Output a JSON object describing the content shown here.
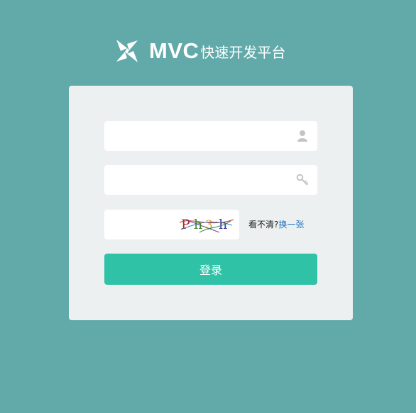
{
  "brand": {
    "logo_icon": "pinwheel-logo-icon",
    "main": "MVC",
    "sub": "快速开发平台"
  },
  "form": {
    "username": {
      "value": "",
      "icon": "user-icon"
    },
    "password": {
      "value": "",
      "icon": "key-icon"
    },
    "captcha": {
      "value": "",
      "image_text": "Ph3h",
      "chars": [
        "P",
        "h",
        "3",
        "h"
      ],
      "char_colors": [
        "#b22a2a",
        "#3a8a2a",
        "#e0a020",
        "#3a3aa0"
      ],
      "tip": "看不清?",
      "refresh_label": "换一张"
    },
    "submit_label": "登录"
  },
  "colors": {
    "background": "#62aaa9",
    "card": "#edf0f1",
    "button": "#2fc2a6",
    "link": "#1e6fc0",
    "icon": "#c4c4c4"
  }
}
